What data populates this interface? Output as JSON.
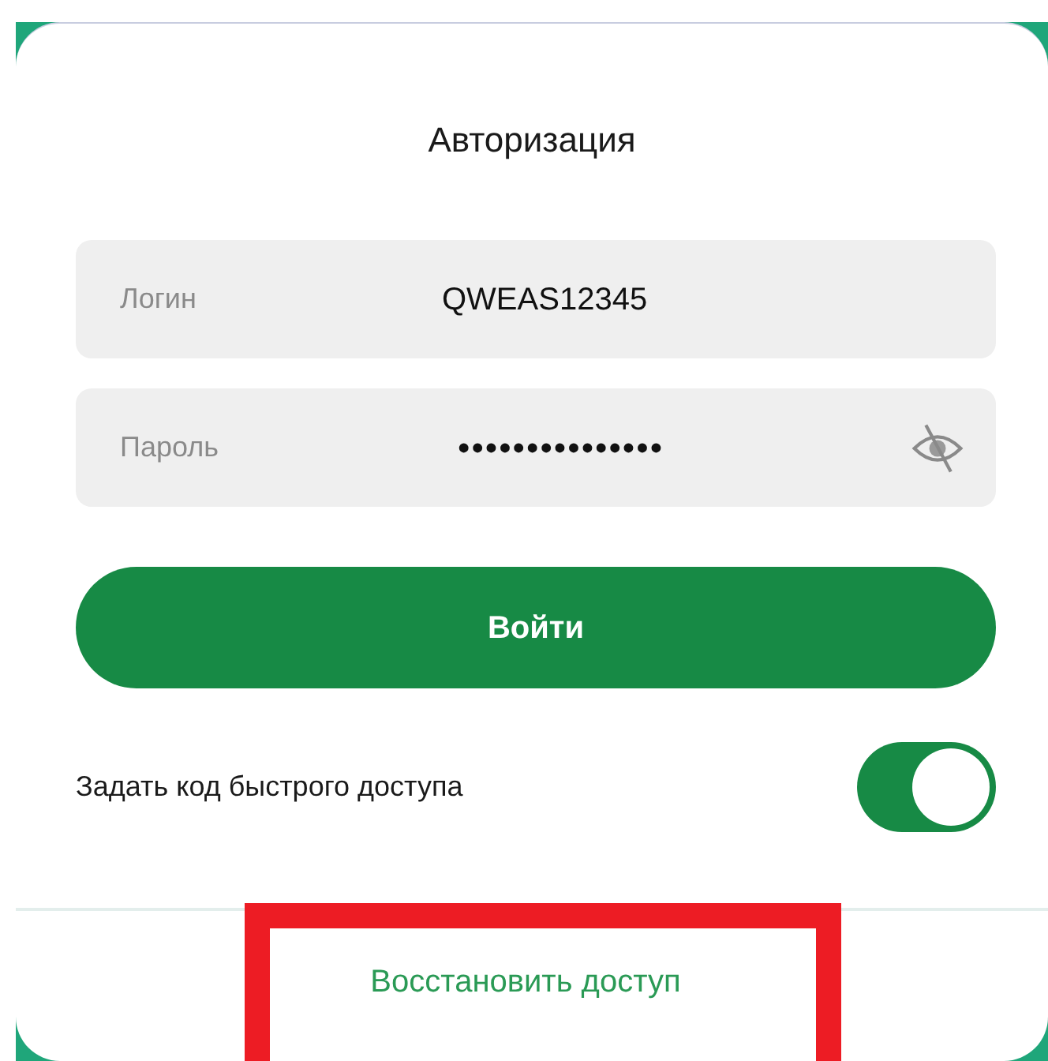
{
  "title": "Авторизация",
  "fields": [
    {
      "kind": "text",
      "label": "Логин",
      "value": "QWEAS12345"
    },
    {
      "kind": "password",
      "label": "Пароль",
      "value": "•••••••••••••••",
      "reveal_button": true
    }
  ],
  "submit_button": "Войти",
  "quick_access": {
    "label": "Задать код быстрого доступа",
    "on": true
  },
  "recover_link": {
    "label": "Восстановить доступ",
    "highlighted": true
  }
}
